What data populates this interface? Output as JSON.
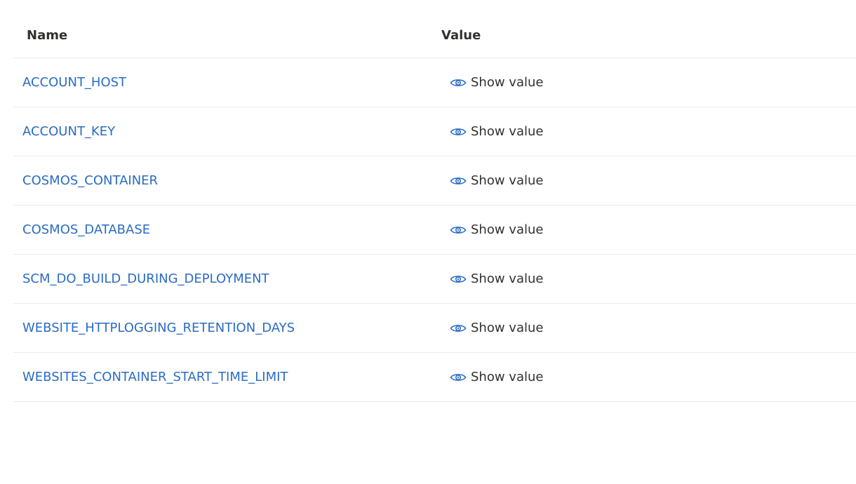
{
  "table": {
    "headers": {
      "name": "Name",
      "value": "Value"
    },
    "rows": [
      {
        "name": "ACCOUNT_HOST",
        "action": "Show value"
      },
      {
        "name": "ACCOUNT_KEY",
        "action": "Show value"
      },
      {
        "name": "COSMOS_CONTAINER",
        "action": "Show value"
      },
      {
        "name": "COSMOS_DATABASE",
        "action": "Show value"
      },
      {
        "name": "SCM_DO_BUILD_DURING_DEPLOYMENT",
        "action": "Show value"
      },
      {
        "name": "WEBSITE_HTTPLOGGING_RETENTION_DAYS",
        "action": "Show value"
      },
      {
        "name": "WEBSITES_CONTAINER_START_TIME_LIMIT",
        "action": "Show value"
      }
    ]
  },
  "icons": {
    "show": "eye-icon"
  },
  "colors": {
    "link": "#2b6cc4",
    "text": "#323130",
    "divider": "#ececec"
  }
}
